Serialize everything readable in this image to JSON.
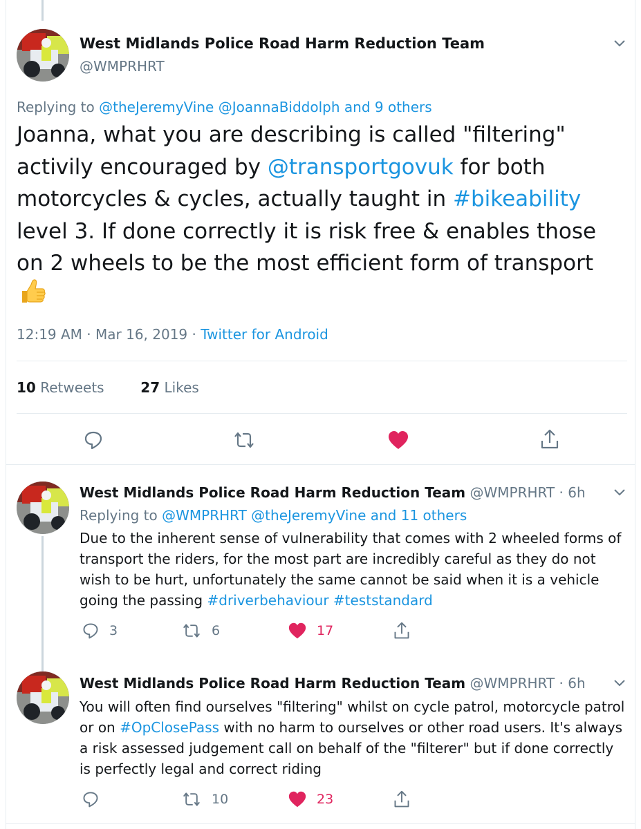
{
  "main_tweet": {
    "author_name": "West Midlands Police Road Harm Reduction Team",
    "handle": "@WMPRHRT",
    "replying_label": "Replying to",
    "replying_mentions": [
      "@theJeremyVine",
      "@JoannaBiddolph"
    ],
    "replying_others": "and 9 others",
    "text": [
      {
        "t": "Joanna, what you are describing is called \"filtering\" activily encouraged by "
      },
      {
        "t": "@transportgovuk",
        "link": true
      },
      {
        "t": " for both motorcycles & cycles, actually taught in "
      },
      {
        "t": "#bikeability",
        "link": true
      },
      {
        "t": " level 3. If done correctly it is risk free & enables those on 2 wheels to be the most efficient form of transport"
      }
    ],
    "emoji": "thumbs-up",
    "timestamp": "12:19 AM · Mar 16, 2019 · ",
    "source": "Twitter for Android",
    "retweets_count": "10",
    "retweets_label": "Retweets",
    "likes_count": "27",
    "likes_label": "Likes",
    "liked": true
  },
  "replies": [
    {
      "author_name": "West Midlands Police Road Harm Reduction Team",
      "handle_time": "@WMPRHRT · 6h",
      "replying_label": "Replying to",
      "replying_mentions": [
        "@WMPRHRT",
        "@theJeremyVine"
      ],
      "replying_others": "and 11 others",
      "text": [
        {
          "t": "Due to the inherent sense of vulnerability that comes with 2 wheeled forms of transport the riders, for the most part are incredibly careful as they do not wish to be hurt, unfortunately the same cannot be said when it is a vehicle going the passing "
        },
        {
          "t": "#driverbehaviour",
          "link": true
        },
        {
          "t": " "
        },
        {
          "t": "#teststandard",
          "link": true
        }
      ],
      "reply_count": "3",
      "retweet_count": "6",
      "like_count": "17"
    },
    {
      "author_name": "West Midlands Police Road Harm Reduction Team",
      "handle_time": "@WMPRHRT · 6h",
      "text": [
        {
          "t": "You will often find ourselves \"filtering\" whilst on cycle patrol, motorcycle patrol or on "
        },
        {
          "t": "#OpClosePass",
          "link": true
        },
        {
          "t": " with no harm to ourselves or other road users. It's always a risk assessed judgement call on behalf of the \"filterer\" but if done correctly is perfectly legal and correct riding"
        }
      ],
      "reply_count": "",
      "retweet_count": "10",
      "like_count": "23"
    }
  ],
  "icons": {
    "reply": "reply-icon",
    "retweet": "retweet-icon",
    "like": "heart-icon",
    "share": "share-icon",
    "caret": "chevron-down-icon"
  },
  "colors": {
    "link": "#1b95e0",
    "secondary_text": "#657786",
    "like": "#e0245e",
    "divider": "#e6ecf0"
  }
}
